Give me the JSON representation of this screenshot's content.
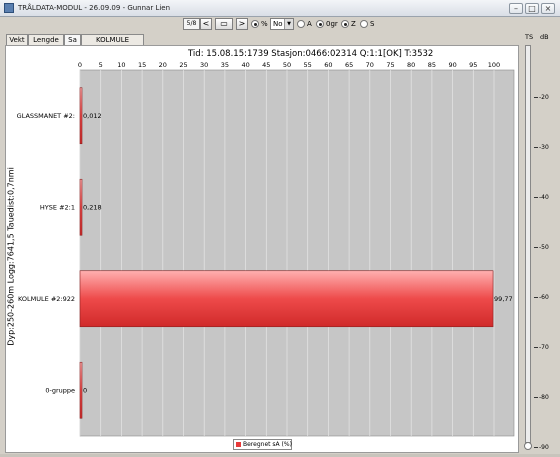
{
  "window": {
    "title": "TRÅLDATA-MODUL - 26.09.09 - Gunnar Lien",
    "minimize": "–",
    "maximize": "□",
    "close": "×"
  },
  "toolbar": {
    "counter": "5/8",
    "prev_icon": "chevron-left-icon",
    "prev": "<",
    "tool_icon": "screen-icon",
    "tool": "▭",
    "next_icon": "chevron-right-icon",
    "next": ">",
    "unit_options": [
      {
        "label": "%",
        "checked": true
      },
      {
        "label": "No",
        "checked": false
      }
    ],
    "combo_value": "No",
    "combo_arrow": "▼",
    "mode_options": [
      {
        "label": "A",
        "checked": false
      },
      {
        "label": "0gr",
        "checked": true
      },
      {
        "label": "Z",
        "checked": true
      },
      {
        "label": "S",
        "checked": false
      }
    ]
  },
  "tabs": [
    {
      "label": "Vekt",
      "active": false
    },
    {
      "label": "Lengde",
      "active": false
    },
    {
      "label": "Sa",
      "active": true
    },
    {
      "label": "KOLMULE #2:922",
      "active": false
    }
  ],
  "right_panel": {
    "ts_label": "TS",
    "db_label": "dB",
    "db_ticks": [
      "-20",
      "-30",
      "-40",
      "-50",
      "-60",
      "-70",
      "-80",
      "-90"
    ]
  },
  "chart_data": {
    "type": "bar",
    "orientation": "horizontal",
    "title": "Tid: 15.08.15:1739   Stasjon:0466:02314   Q:1:1[OK]  T:3532",
    "ylabel": "Dyp:250-260m Logg:7641,5 Tauedist:0,7nmi",
    "xlabel": "",
    "xlim": [
      0,
      100
    ],
    "x_ticks": [
      "0",
      "5",
      "10",
      "15",
      "20",
      "25",
      "30",
      "35",
      "40",
      "45",
      "50",
      "55",
      "60",
      "65",
      "70",
      "75",
      "80",
      "85",
      "90",
      "95",
      "100"
    ],
    "categories": [
      "GLASSMANET #2:",
      "HYSE #2:1",
      "KOLMULE #2:922",
      "0-gruppe"
    ],
    "series": [
      {
        "name": "Beregnet sA (%)",
        "values": [
          0.012,
          0.218,
          99.77,
          0
        ],
        "labels": [
          "0,012",
          "0,218",
          "99,77",
          "0"
        ]
      }
    ],
    "bar_color": "#e83a3a",
    "grid": true,
    "legend": "bottom-center"
  }
}
